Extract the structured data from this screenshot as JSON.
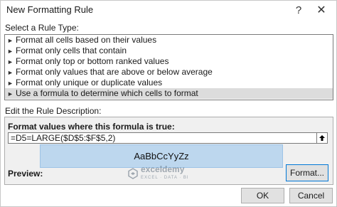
{
  "window": {
    "title": "New Formatting Rule",
    "help_glyph": "?",
    "close_glyph": "✕"
  },
  "rule_type": {
    "label": "Select a Rule Type:",
    "items": [
      "Format all cells based on their values",
      "Format only cells that contain",
      "Format only top or bottom ranked values",
      "Format only values that are above or below average",
      "Format only unique or duplicate values",
      "Use a formula to determine which cells to format"
    ],
    "selected_index": 5,
    "bullet": "►"
  },
  "description": {
    "label": "Edit the Rule Description:",
    "formula_label": "Format values where this formula is true:",
    "formula_value": "=D5=LARGE($D$5:$F$5,2)",
    "collapse_glyph": "🡅",
    "preview_label": "Preview:",
    "preview_sample": "AaBbCcYyZz",
    "preview_fill": "#bdd7ee",
    "format_button": "Format..."
  },
  "buttons": {
    "ok": "OK",
    "cancel": "Cancel"
  },
  "watermark": {
    "name": "exceldemy",
    "tagline": "EXCEL · DATA · BI"
  }
}
